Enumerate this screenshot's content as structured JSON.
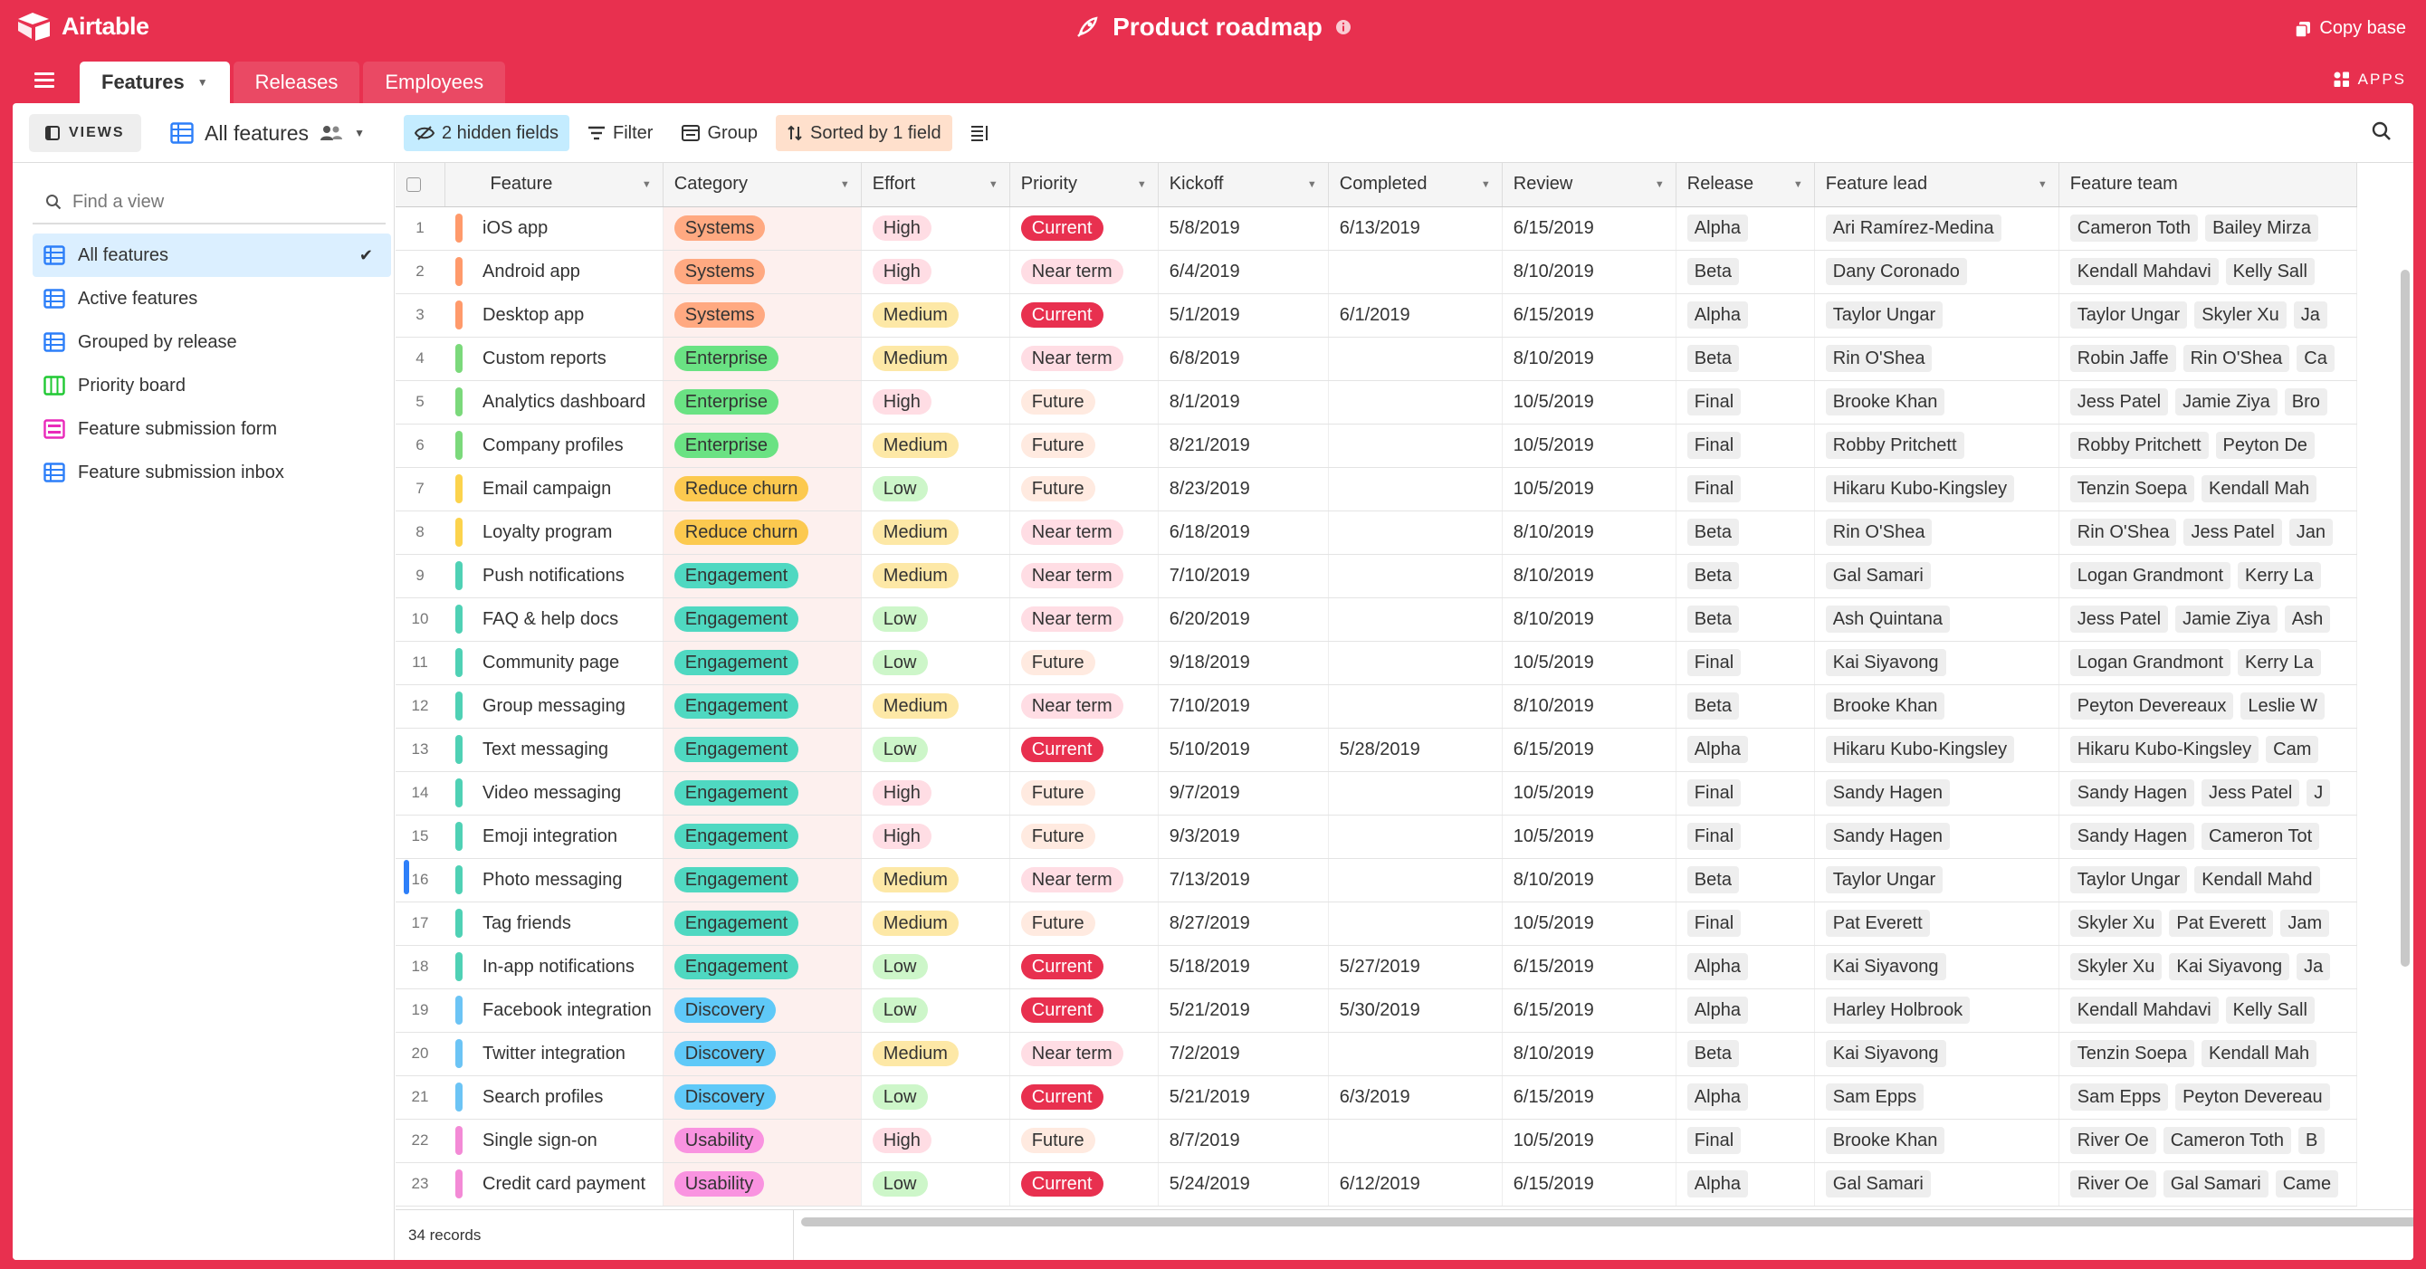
{
  "app": {
    "name": "Airtable",
    "base_title": "Product roadmap",
    "copy_base": "Copy base",
    "apps_label": "APPS"
  },
  "tabs": [
    {
      "label": "Features"
    },
    {
      "label": "Releases"
    },
    {
      "label": "Employees"
    }
  ],
  "viewbar": {
    "views_label": "VIEWS",
    "current_view": "All features",
    "hidden_fields": "2 hidden fields",
    "filter": "Filter",
    "group": "Group",
    "sorted": "Sorted by 1 field"
  },
  "sidebar": {
    "find_placeholder": "Find a view",
    "views": [
      {
        "label": "All features",
        "type": "grid",
        "selected": true
      },
      {
        "label": "Active features",
        "type": "grid"
      },
      {
        "label": "Grouped by release",
        "type": "grid"
      },
      {
        "label": "Priority board",
        "type": "kanban"
      },
      {
        "label": "Feature submission form",
        "type": "form"
      },
      {
        "label": "Feature submission inbox",
        "type": "grid"
      }
    ]
  },
  "columns": [
    "Feature",
    "Category",
    "Effort",
    "Priority",
    "Kickoff",
    "Completed",
    "Review",
    "Release",
    "Feature lead",
    "Feature team"
  ],
  "colors": {
    "brand": "#e8304f",
    "Systems": "#ff9a6b",
    "Enterprise": "#7bd97b",
    "Reduce churn": "#fcd34d",
    "Engagement": "#4fd1b5",
    "Discovery": "#6cc4f5",
    "Usability": "#f38ad6"
  },
  "rows": [
    {
      "n": "1",
      "feature": "iOS app",
      "category": "Systems",
      "effort": "High",
      "priority": "Current",
      "kickoff": "5/8/2019",
      "completed": "6/13/2019",
      "review": "6/15/2019",
      "release": "Alpha",
      "lead": "Ari Ramírez-Medina",
      "team": [
        "Cameron Toth",
        "Bailey Mirza"
      ]
    },
    {
      "n": "2",
      "feature": "Android app",
      "category": "Systems",
      "effort": "High",
      "priority": "Near term",
      "kickoff": "6/4/2019",
      "completed": "",
      "review": "8/10/2019",
      "release": "Beta",
      "lead": "Dany Coronado",
      "team": [
        "Kendall Mahdavi",
        "Kelly Sall"
      ]
    },
    {
      "n": "3",
      "feature": "Desktop app",
      "category": "Systems",
      "effort": "Medium",
      "priority": "Current",
      "kickoff": "5/1/2019",
      "completed": "6/1/2019",
      "review": "6/15/2019",
      "release": "Alpha",
      "lead": "Taylor Ungar",
      "team": [
        "Taylor Ungar",
        "Skyler Xu",
        "Ja"
      ]
    },
    {
      "n": "4",
      "feature": "Custom reports",
      "category": "Enterprise",
      "effort": "Medium",
      "priority": "Near term",
      "kickoff": "6/8/2019",
      "completed": "",
      "review": "8/10/2019",
      "release": "Beta",
      "lead": "Rin O'Shea",
      "team": [
        "Robin Jaffe",
        "Rin O'Shea",
        "Ca"
      ]
    },
    {
      "n": "5",
      "feature": "Analytics dashboard",
      "category": "Enterprise",
      "effort": "High",
      "priority": "Future",
      "kickoff": "8/1/2019",
      "completed": "",
      "review": "10/5/2019",
      "release": "Final",
      "lead": "Brooke Khan",
      "team": [
        "Jess Patel",
        "Jamie Ziya",
        "Bro"
      ]
    },
    {
      "n": "6",
      "feature": "Company profiles",
      "category": "Enterprise",
      "effort": "Medium",
      "priority": "Future",
      "kickoff": "8/21/2019",
      "completed": "",
      "review": "10/5/2019",
      "release": "Final",
      "lead": "Robby Pritchett",
      "team": [
        "Robby Pritchett",
        "Peyton De"
      ]
    },
    {
      "n": "7",
      "feature": "Email campaign",
      "category": "Reduce churn",
      "effort": "Low",
      "priority": "Future",
      "kickoff": "8/23/2019",
      "completed": "",
      "review": "10/5/2019",
      "release": "Final",
      "lead": "Hikaru Kubo-Kingsley",
      "team": [
        "Tenzin Soepa",
        "Kendall Mah"
      ]
    },
    {
      "n": "8",
      "feature": "Loyalty program",
      "category": "Reduce churn",
      "effort": "Medium",
      "priority": "Near term",
      "kickoff": "6/18/2019",
      "completed": "",
      "review": "8/10/2019",
      "release": "Beta",
      "lead": "Rin O'Shea",
      "team": [
        "Rin O'Shea",
        "Jess Patel",
        "Jan"
      ]
    },
    {
      "n": "9",
      "feature": "Push notifications",
      "category": "Engagement",
      "effort": "Medium",
      "priority": "Near term",
      "kickoff": "7/10/2019",
      "completed": "",
      "review": "8/10/2019",
      "release": "Beta",
      "lead": "Gal Samari",
      "team": [
        "Logan Grandmont",
        "Kerry La"
      ]
    },
    {
      "n": "10",
      "feature": "FAQ & help docs",
      "category": "Engagement",
      "effort": "Low",
      "priority": "Near term",
      "kickoff": "6/20/2019",
      "completed": "",
      "review": "8/10/2019",
      "release": "Beta",
      "lead": "Ash Quintana",
      "team": [
        "Jess Patel",
        "Jamie Ziya",
        "Ash"
      ]
    },
    {
      "n": "11",
      "feature": "Community page",
      "category": "Engagement",
      "effort": "Low",
      "priority": "Future",
      "kickoff": "9/18/2019",
      "completed": "",
      "review": "10/5/2019",
      "release": "Final",
      "lead": "Kai Siyavong",
      "team": [
        "Logan Grandmont",
        "Kerry La"
      ]
    },
    {
      "n": "12",
      "feature": "Group messaging",
      "category": "Engagement",
      "effort": "Medium",
      "priority": "Near term",
      "kickoff": "7/10/2019",
      "completed": "",
      "review": "8/10/2019",
      "release": "Beta",
      "lead": "Brooke Khan",
      "team": [
        "Peyton Devereaux",
        "Leslie W"
      ]
    },
    {
      "n": "13",
      "feature": "Text messaging",
      "category": "Engagement",
      "effort": "Low",
      "priority": "Current",
      "kickoff": "5/10/2019",
      "completed": "5/28/2019",
      "review": "6/15/2019",
      "release": "Alpha",
      "lead": "Hikaru Kubo-Kingsley",
      "team": [
        "Hikaru Kubo-Kingsley",
        "Cam"
      ]
    },
    {
      "n": "14",
      "feature": "Video messaging",
      "category": "Engagement",
      "effort": "High",
      "priority": "Future",
      "kickoff": "9/7/2019",
      "completed": "",
      "review": "10/5/2019",
      "release": "Final",
      "lead": "Sandy Hagen",
      "team": [
        "Sandy Hagen",
        "Jess Patel",
        "J"
      ]
    },
    {
      "n": "15",
      "feature": "Emoji integration",
      "category": "Engagement",
      "effort": "High",
      "priority": "Future",
      "kickoff": "9/3/2019",
      "completed": "",
      "review": "10/5/2019",
      "release": "Final",
      "lead": "Sandy Hagen",
      "team": [
        "Sandy Hagen",
        "Cameron Tot"
      ]
    },
    {
      "n": "16",
      "feature": "Photo messaging",
      "category": "Engagement",
      "effort": "Medium",
      "priority": "Near term",
      "kickoff": "7/13/2019",
      "completed": "",
      "review": "8/10/2019",
      "release": "Beta",
      "lead": "Taylor Ungar",
      "team": [
        "Taylor Ungar",
        "Kendall Mahd"
      ]
    },
    {
      "n": "17",
      "feature": "Tag friends",
      "category": "Engagement",
      "effort": "Medium",
      "priority": "Future",
      "kickoff": "8/27/2019",
      "completed": "",
      "review": "10/5/2019",
      "release": "Final",
      "lead": "Pat Everett",
      "team": [
        "Skyler Xu",
        "Pat Everett",
        "Jam"
      ]
    },
    {
      "n": "18",
      "feature": "In-app notifications",
      "category": "Engagement",
      "effort": "Low",
      "priority": "Current",
      "kickoff": "5/18/2019",
      "completed": "5/27/2019",
      "review": "6/15/2019",
      "release": "Alpha",
      "lead": "Kai Siyavong",
      "team": [
        "Skyler Xu",
        "Kai Siyavong",
        "Ja"
      ]
    },
    {
      "n": "19",
      "feature": "Facebook integration",
      "category": "Discovery",
      "effort": "Low",
      "priority": "Current",
      "kickoff": "5/21/2019",
      "completed": "5/30/2019",
      "review": "6/15/2019",
      "release": "Alpha",
      "lead": "Harley Holbrook",
      "team": [
        "Kendall Mahdavi",
        "Kelly Sall"
      ]
    },
    {
      "n": "20",
      "feature": "Twitter integration",
      "category": "Discovery",
      "effort": "Medium",
      "priority": "Near term",
      "kickoff": "7/2/2019",
      "completed": "",
      "review": "8/10/2019",
      "release": "Beta",
      "lead": "Kai Siyavong",
      "team": [
        "Tenzin Soepa",
        "Kendall Mah"
      ]
    },
    {
      "n": "21",
      "feature": "Search profiles",
      "category": "Discovery",
      "effort": "Low",
      "priority": "Current",
      "kickoff": "5/21/2019",
      "completed": "6/3/2019",
      "review": "6/15/2019",
      "release": "Alpha",
      "lead": "Sam Epps",
      "team": [
        "Sam Epps",
        "Peyton Devereau"
      ]
    },
    {
      "n": "22",
      "feature": "Single sign-on",
      "category": "Usability",
      "effort": "High",
      "priority": "Future",
      "kickoff": "8/7/2019",
      "completed": "",
      "review": "10/5/2019",
      "release": "Final",
      "lead": "Brooke Khan",
      "team": [
        "River Oe",
        "Cameron Toth",
        "B"
      ]
    },
    {
      "n": "23",
      "feature": "Credit card payment",
      "category": "Usability",
      "effort": "Low",
      "priority": "Current",
      "kickoff": "5/24/2019",
      "completed": "6/12/2019",
      "review": "6/15/2019",
      "release": "Alpha",
      "lead": "Gal Samari",
      "team": [
        "River Oe",
        "Gal Samari",
        "Came"
      ]
    }
  ],
  "footer": {
    "record_count": "34 records"
  }
}
